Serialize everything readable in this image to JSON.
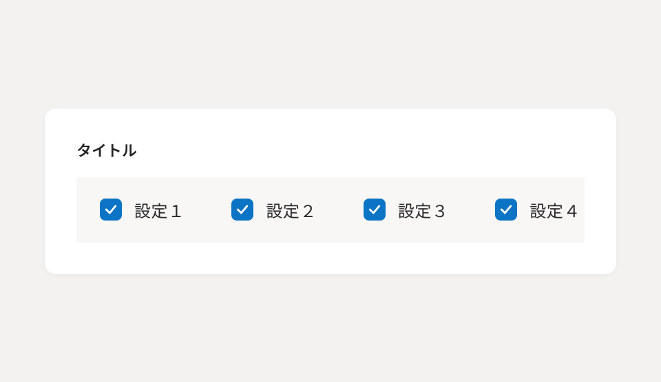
{
  "card": {
    "title": "タイトル",
    "options": [
      {
        "label": "設定１",
        "checked": true
      },
      {
        "label": "設定２",
        "checked": true
      },
      {
        "label": "設定３",
        "checked": true
      },
      {
        "label": "設定４",
        "checked": true
      }
    ]
  },
  "colors": {
    "accent": "#0b74c4"
  }
}
